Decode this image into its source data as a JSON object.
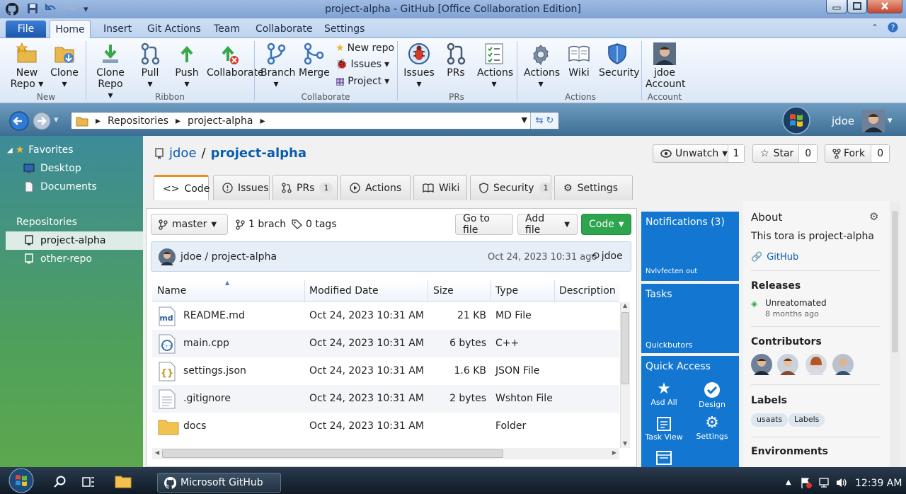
{
  "window": {
    "title": "project-alpha - GitHub [Office Collaboration Edition]"
  },
  "menu": {
    "file": "File",
    "tabs": [
      "Home",
      "Insert",
      "Git Actions",
      "Team",
      "Collaborate",
      "Settings"
    ]
  },
  "ribbon": {
    "new_repo": "New",
    "new_repo2": "Repo",
    "clone": "Clone",
    "clone_repo": "Clone",
    "clone_repo2": "Repo",
    "pull": "Pull",
    "push": "Push",
    "collaborate": "Collaborate",
    "branch": "Branch",
    "merge": "Merge",
    "small_new_repo": "New repo",
    "small_issues": "Issues",
    "small_project": "Project",
    "issues": "Issues",
    "prs": "PRs",
    "actions": "Actions",
    "actions2": "Actions",
    "wiki": "Wiki",
    "security": "Security",
    "account_user": "jdoe",
    "account": "Account",
    "groups": {
      "new": "New",
      "ribbon": "Ribbon",
      "collaborate": "Collaborate",
      "prs": "PRs",
      "actions": "Actions",
      "account": "Account"
    }
  },
  "address": {
    "crumbs": [
      "Repositories",
      "project-alpha"
    ],
    "user": "jdoe"
  },
  "sidebar": {
    "favorites": "Favorites",
    "fav_items": [
      "Desktop",
      "Documents"
    ],
    "repositories": "Repositories",
    "repos": [
      "project-alpha",
      "other-repo"
    ]
  },
  "repo": {
    "owner": "jdoe",
    "sep": "/",
    "name": "project-alpha",
    "unwatch": "Unwatch",
    "unwatch_count": "1",
    "star": "Star",
    "star_count": "0",
    "fork": "Fork",
    "fork_count": "0",
    "tabs": [
      {
        "label": "Code"
      },
      {
        "label": "Issues"
      },
      {
        "label": "PRs",
        "badge": "1"
      },
      {
        "label": "Actions"
      },
      {
        "label": "Wiki"
      },
      {
        "label": "Security",
        "badge": "1"
      },
      {
        "label": "Settings"
      }
    ],
    "branch": "master",
    "branches": "1 brach",
    "tags": "0 tags",
    "goto_file": "Go to file",
    "add_file": "Add file",
    "code": "Code",
    "commit": {
      "path": "jdoe / project-alpha",
      "date": "Oct 24, 2023 10:31 ago",
      "user": "jdoe"
    },
    "columns": [
      "Name",
      "Modified Date",
      "Size",
      "Type",
      "Description"
    ],
    "files": [
      {
        "name": "README.md",
        "date": "Oct 24, 2023 10:31 AM",
        "size": "21 KB",
        "type": "MD File"
      },
      {
        "name": "main.cpp",
        "date": "Oct 24, 2023 10:31 AM",
        "size": "6 bytes",
        "type": "C++"
      },
      {
        "name": "settings.json",
        "date": "Oct 24, 2023 10:31 AM",
        "size": "1.6 KB",
        "type": "JSON File"
      },
      {
        "name": ".gitignore",
        "date": "Oct 24, 2023 10:31 AM",
        "size": "2 bytes",
        "type": "Wshton File"
      },
      {
        "name": "docs",
        "date": "Oct 24, 2023 10:31 AM",
        "size": "",
        "type": "Folder"
      }
    ]
  },
  "tiles": {
    "notifications": "Notifications (3)",
    "notif_sub": "Nvlvfecten out",
    "tasks": "Tasks",
    "tasks_sub": "Quickbutors",
    "quick": "Quick Access",
    "quick_items": [
      "Asd All",
      "Design",
      "Task View",
      "Settings"
    ]
  },
  "about": {
    "title": "About",
    "desc": "This tora is project-alpha",
    "link": "GitHub",
    "releases": "Releases",
    "release_name": "Unreatomated",
    "release_date": "8 months ago",
    "contributors": "Contributors",
    "labels": "Labels",
    "label_items": [
      "usaats",
      "Labels"
    ],
    "environments": "Environments"
  },
  "taskbar": {
    "app": "Microsoft GitHub",
    "time": "12:39 AM"
  },
  "colors": {
    "accent": "#1377d1",
    "green": "#2da44e",
    "link": "#0b5cad"
  }
}
